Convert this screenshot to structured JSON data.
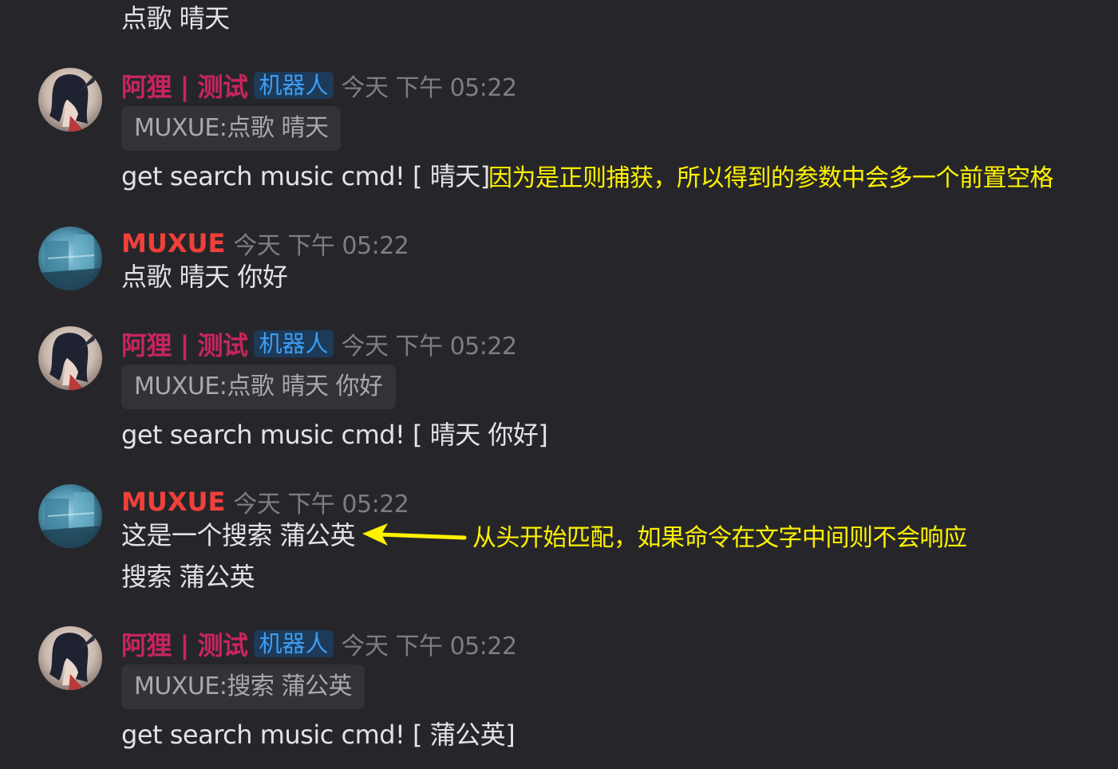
{
  "messages": [
    {
      "text": "点歌 晴天"
    },
    {
      "author": "阿狸 | 测试",
      "tag": "机器人",
      "time": "今天 下午 05:22",
      "quote": "MUXUE:点歌 晴天",
      "text": "get search music cmd! [ 晴天]",
      "annotation": "因为是正则捕获，所以得到的参数中会多一个前置空格"
    },
    {
      "author": "MUXUE",
      "time": "今天 下午 05:22",
      "text": "点歌 晴天 你好"
    },
    {
      "author": "阿狸 | 测试",
      "tag": "机器人",
      "time": "今天 下午 05:22",
      "quote": "MUXUE:点歌 晴天 你好",
      "text": "get search music cmd! [ 晴天 你好]"
    },
    {
      "author": "MUXUE",
      "time": "今天 下午 05:22",
      "text": "这是一个搜索 蒲公英",
      "text2": "搜索 蒲公英",
      "annotation": "从头开始匹配，如果命令在文字中间则不会响应"
    },
    {
      "author": "阿狸 | 测试",
      "tag": "机器人",
      "time": "今天 下午 05:22",
      "quote": "MUXUE:搜索 蒲公英",
      "text": "get search music cmd! [ 蒲公英]"
    }
  ],
  "colors": {
    "background": "#26262a",
    "bot_name": "#c8255d",
    "user_name": "#f0403a",
    "bot_tag_text": "#3c9df2",
    "bot_tag_bg": "#1d3a59",
    "annotation": "#fff200"
  },
  "icons": {
    "bot_avatar": "anime-avatar-icon",
    "user_avatar": "blue-landscape-avatar-icon",
    "annotation_arrow": "arrow-left-icon"
  }
}
